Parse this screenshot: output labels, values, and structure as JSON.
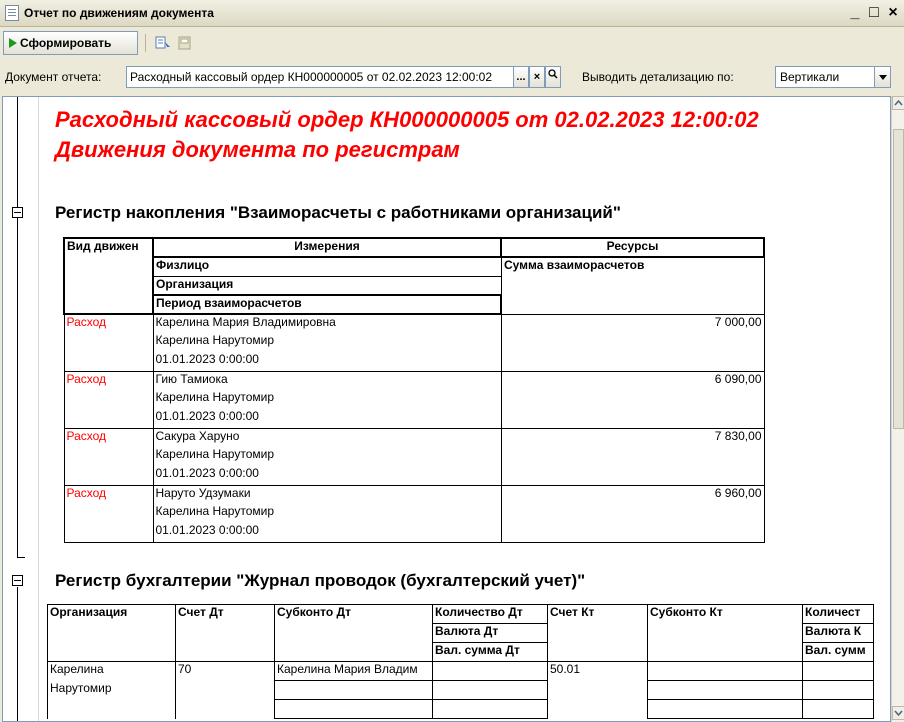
{
  "window": {
    "title": "Отчет по движениям документа",
    "controls": {
      "minimize": "_",
      "maximize": "□",
      "close": "×"
    }
  },
  "toolbar": {
    "generate_label": "Сформировать",
    "icons": [
      "play-icon",
      "settings-icon",
      "save-icon"
    ]
  },
  "params": {
    "doc_label": "Документ отчета:",
    "doc_value": "Расходный кассовый ордер КН000000005 от 02.02.2023 12:00:02",
    "doc_select_btn": "...",
    "doc_clear_btn": "×",
    "doc_open_btn": "Q",
    "detail_label": "Выводить детализацию по:",
    "detail_value": "Вертикали"
  },
  "report": {
    "title_line1": "Расходный кассовый ордер КН000000005 от 02.02.2023 12:00:02",
    "title_line2": "Движения документа по регистрам",
    "register1": {
      "title": "Регистр накопления \"Взаиморасчеты с работниками организаций\"",
      "headers": {
        "col_kind": "Вид движен",
        "dimensions": "Измерения",
        "resources": "Ресурсы",
        "dim1": "Физлицо",
        "dim2": "Организация",
        "dim3": "Период взаиморасчетов",
        "res1": "Сумма взаиморасчетов"
      },
      "rows": [
        {
          "kind": "Расход",
          "person": "Карелина Мария Владимировна",
          "org": "Карелина Нарутомир",
          "period": "01.01.2023 0:00:00",
          "sum": "7 000,00"
        },
        {
          "kind": "Расход",
          "person": "Гию Тамиока",
          "org": "Карелина Нарутомир",
          "period": "01.01.2023 0:00:00",
          "sum": "6 090,00"
        },
        {
          "kind": "Расход",
          "person": "Сакура Харуно",
          "org": "Карелина Нарутомир",
          "period": "01.01.2023 0:00:00",
          "sum": "7 830,00"
        },
        {
          "kind": "Расход",
          "person": "Наруто Удзумаки",
          "org": "Карелина Нарутомир",
          "period": "01.01.2023 0:00:00",
          "sum": "6 960,00"
        }
      ]
    },
    "register2": {
      "title": "Регистр бухгалтерии \"Журнал проводок (бухгалтерский учет)\"",
      "headers": {
        "org": "Организация",
        "acc_dt": "Счет Дт",
        "sub_dt": "Субконто Дт",
        "qty_dt": "Количество Дт",
        "cur_dt": "Валюта Дт",
        "cursum_dt": "Вал. сумма Дт",
        "acc_kt": "Счет Кт",
        "sub_kt": "Субконто Кт",
        "qty_kt": "Количест",
        "cur_kt": "Валюта К",
        "cursum_kt": "Вал. сумм"
      },
      "rows": [
        {
          "org_line1": "Карелина",
          "org_line2": "Нарутомир",
          "acc_dt": "70",
          "sub_dt": "Карелина Мария Владим",
          "acc_kt": "50.01"
        }
      ]
    }
  }
}
